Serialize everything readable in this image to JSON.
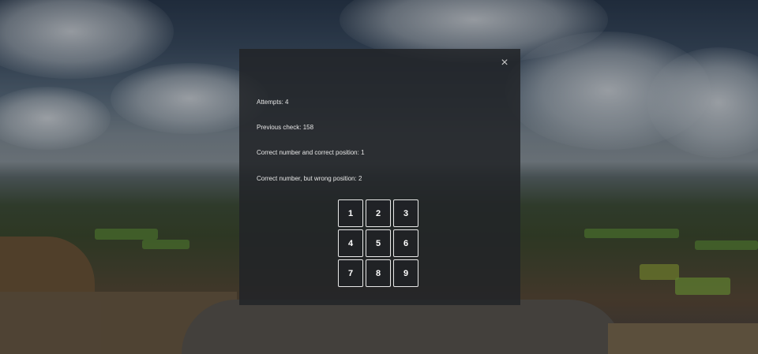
{
  "background": {
    "description_icon": "mountain-landscape-photo"
  },
  "modal": {
    "close_icon": "×",
    "attempts_label": "Attempts:",
    "attempts_value": "4",
    "previous_check_label": "Previous check:",
    "previous_check_value": "158",
    "correct_position_label": "Correct number and correct position:",
    "correct_position_value": "1",
    "wrong_position_label": "Correct number, but wrong position:",
    "wrong_position_value": "2"
  },
  "keypad": {
    "keys": [
      "1",
      "2",
      "3",
      "4",
      "5",
      "6",
      "7",
      "8",
      "9"
    ]
  },
  "colors": {
    "modal_bg": "#222428",
    "text": "#e6e6e6",
    "key_border": "#e8e8e8"
  }
}
